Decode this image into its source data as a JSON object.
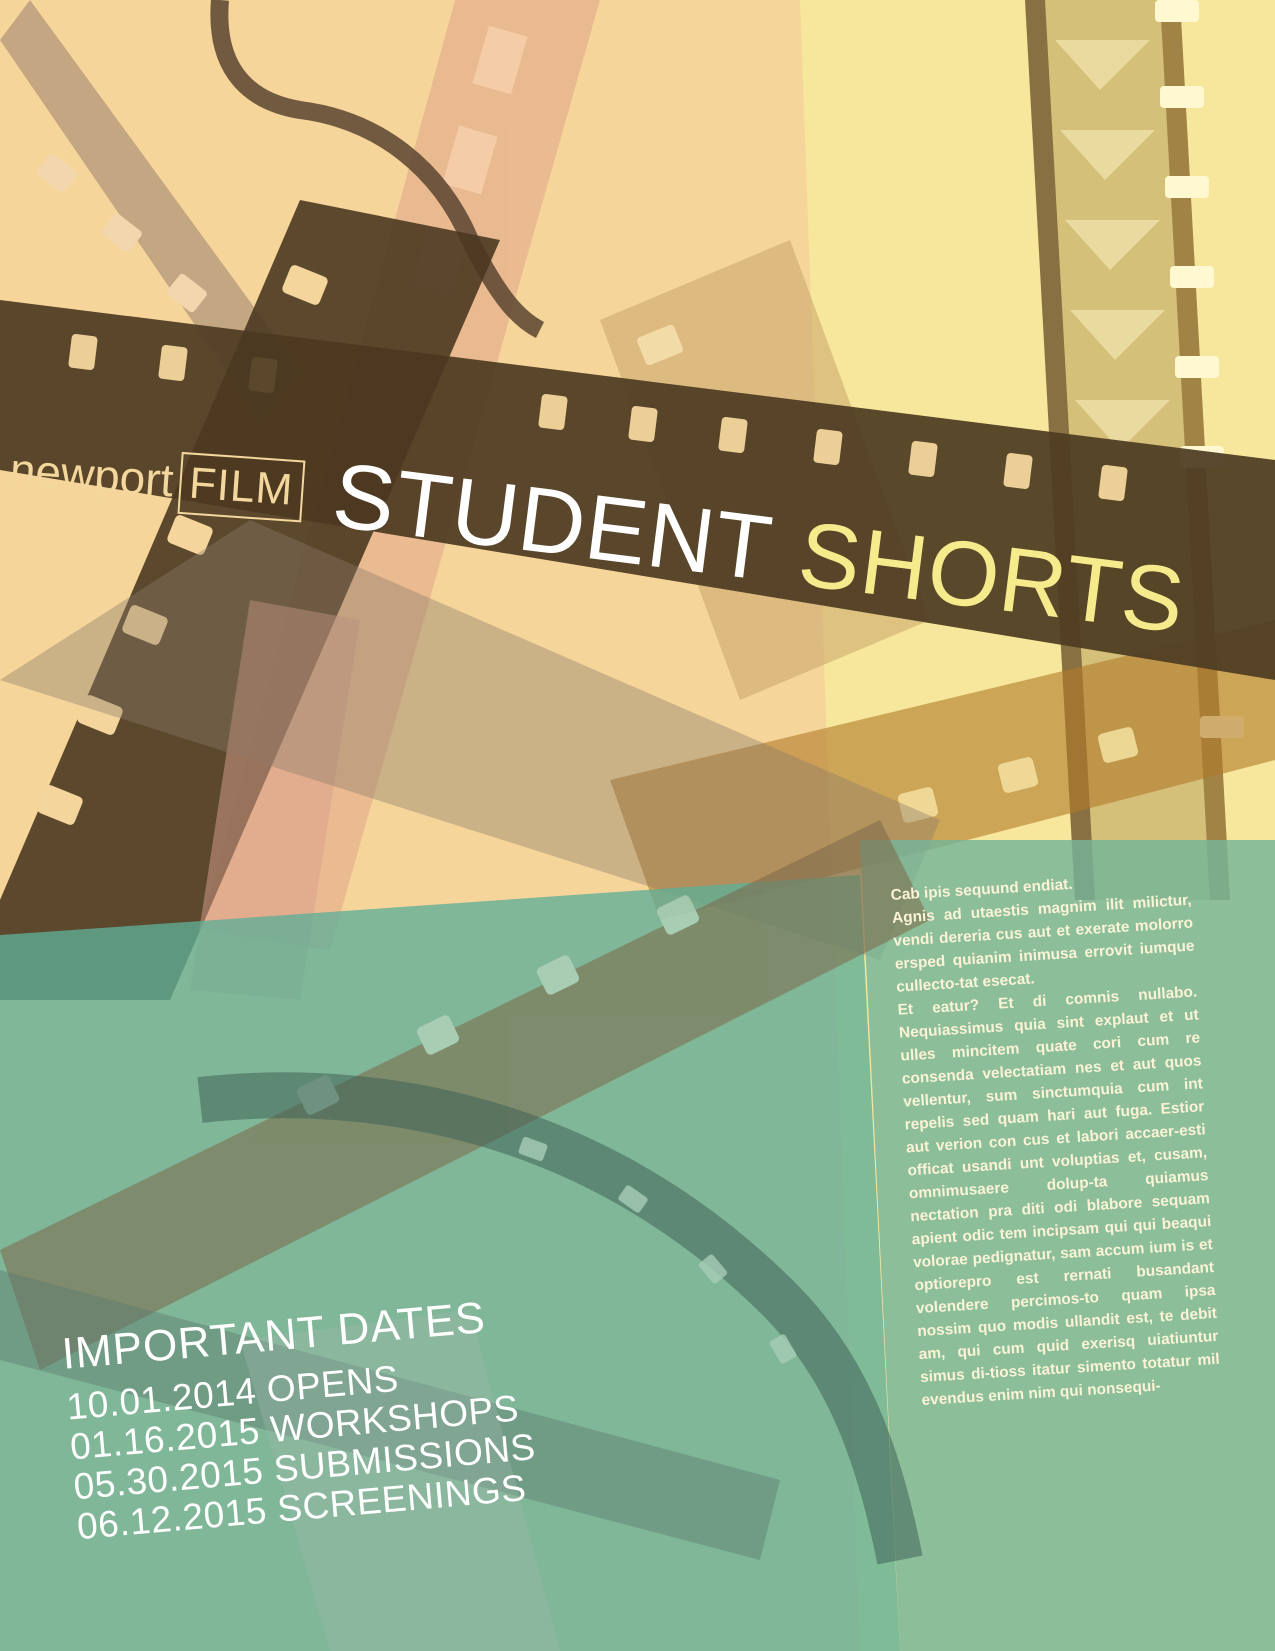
{
  "logo": {
    "word": "newport",
    "boxed_word": "FILM"
  },
  "title": {
    "line_part1": "STUDENT",
    "line_part2": "SHORTS"
  },
  "important_dates": {
    "heading": "IMPORTANT DATES",
    "items": [
      "10.01.2014 OPENS",
      "01.16.2015 WORKSHOPS",
      "05.30.2015 SUBMISSIONS",
      "06.12.2015 SCREENINGS"
    ]
  },
  "body": {
    "paragraph1": "Cab ipis sequund endiat.",
    "paragraph2": "Agnis ad utaestis magnim ilit milictur, vendi dereria cus aut et exerate molorro ersped quianim inimusa errovit iumque cullecto-tat esecat.",
    "paragraph3": "Et eatur? Et di comnis nullabo. Nequiassimus quia sint explaut et ut ulles mincitem quate cori cum re consenda velectatiam nes et aut quos vellentur, sum sinctumquia cum int repelis sed quam hari aut fuga. Estior aut verion con cus et labori accaer-esti officat usandi unt voluptias et, cusam, omnimusaere dolup-ta quiamus nectation pra diti odi blabore sequam apient odic tem incipsam qui qui beaqui volorae pedignatur, sam accum ium is et optiorepro est rernati busandant volendere percimos-to quam ipsa nossim quo modis ullandit est, te debit am, qui cum quid exerisq uiatiuntur simus di-tioss itatur simento totatur mil evendus enim nim qui nonsequi-"
  },
  "colors": {
    "peach": "#f6d59a",
    "yellow_panel": "#f8ea9a",
    "teal": "#6fb39a",
    "film_dark": "#4e3b22",
    "title_yellow": "#f6eb8c"
  }
}
